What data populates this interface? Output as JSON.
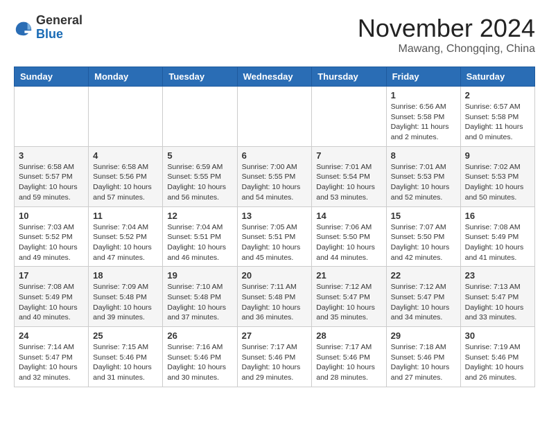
{
  "header": {
    "logo_line1": "General",
    "logo_line2": "Blue",
    "month_title": "November 2024",
    "location": "Mawang, Chongqing, China"
  },
  "days_of_week": [
    "Sunday",
    "Monday",
    "Tuesday",
    "Wednesday",
    "Thursday",
    "Friday",
    "Saturday"
  ],
  "weeks": [
    [
      {
        "day": "",
        "info": ""
      },
      {
        "day": "",
        "info": ""
      },
      {
        "day": "",
        "info": ""
      },
      {
        "day": "",
        "info": ""
      },
      {
        "day": "",
        "info": ""
      },
      {
        "day": "1",
        "info": "Sunrise: 6:56 AM\nSunset: 5:58 PM\nDaylight: 11 hours and 2 minutes."
      },
      {
        "day": "2",
        "info": "Sunrise: 6:57 AM\nSunset: 5:58 PM\nDaylight: 11 hours and 0 minutes."
      }
    ],
    [
      {
        "day": "3",
        "info": "Sunrise: 6:58 AM\nSunset: 5:57 PM\nDaylight: 10 hours and 59 minutes."
      },
      {
        "day": "4",
        "info": "Sunrise: 6:58 AM\nSunset: 5:56 PM\nDaylight: 10 hours and 57 minutes."
      },
      {
        "day": "5",
        "info": "Sunrise: 6:59 AM\nSunset: 5:55 PM\nDaylight: 10 hours and 56 minutes."
      },
      {
        "day": "6",
        "info": "Sunrise: 7:00 AM\nSunset: 5:55 PM\nDaylight: 10 hours and 54 minutes."
      },
      {
        "day": "7",
        "info": "Sunrise: 7:01 AM\nSunset: 5:54 PM\nDaylight: 10 hours and 53 minutes."
      },
      {
        "day": "8",
        "info": "Sunrise: 7:01 AM\nSunset: 5:53 PM\nDaylight: 10 hours and 52 minutes."
      },
      {
        "day": "9",
        "info": "Sunrise: 7:02 AM\nSunset: 5:53 PM\nDaylight: 10 hours and 50 minutes."
      }
    ],
    [
      {
        "day": "10",
        "info": "Sunrise: 7:03 AM\nSunset: 5:52 PM\nDaylight: 10 hours and 49 minutes."
      },
      {
        "day": "11",
        "info": "Sunrise: 7:04 AM\nSunset: 5:52 PM\nDaylight: 10 hours and 47 minutes."
      },
      {
        "day": "12",
        "info": "Sunrise: 7:04 AM\nSunset: 5:51 PM\nDaylight: 10 hours and 46 minutes."
      },
      {
        "day": "13",
        "info": "Sunrise: 7:05 AM\nSunset: 5:51 PM\nDaylight: 10 hours and 45 minutes."
      },
      {
        "day": "14",
        "info": "Sunrise: 7:06 AM\nSunset: 5:50 PM\nDaylight: 10 hours and 44 minutes."
      },
      {
        "day": "15",
        "info": "Sunrise: 7:07 AM\nSunset: 5:50 PM\nDaylight: 10 hours and 42 minutes."
      },
      {
        "day": "16",
        "info": "Sunrise: 7:08 AM\nSunset: 5:49 PM\nDaylight: 10 hours and 41 minutes."
      }
    ],
    [
      {
        "day": "17",
        "info": "Sunrise: 7:08 AM\nSunset: 5:49 PM\nDaylight: 10 hours and 40 minutes."
      },
      {
        "day": "18",
        "info": "Sunrise: 7:09 AM\nSunset: 5:48 PM\nDaylight: 10 hours and 39 minutes."
      },
      {
        "day": "19",
        "info": "Sunrise: 7:10 AM\nSunset: 5:48 PM\nDaylight: 10 hours and 37 minutes."
      },
      {
        "day": "20",
        "info": "Sunrise: 7:11 AM\nSunset: 5:48 PM\nDaylight: 10 hours and 36 minutes."
      },
      {
        "day": "21",
        "info": "Sunrise: 7:12 AM\nSunset: 5:47 PM\nDaylight: 10 hours and 35 minutes."
      },
      {
        "day": "22",
        "info": "Sunrise: 7:12 AM\nSunset: 5:47 PM\nDaylight: 10 hours and 34 minutes."
      },
      {
        "day": "23",
        "info": "Sunrise: 7:13 AM\nSunset: 5:47 PM\nDaylight: 10 hours and 33 minutes."
      }
    ],
    [
      {
        "day": "24",
        "info": "Sunrise: 7:14 AM\nSunset: 5:47 PM\nDaylight: 10 hours and 32 minutes."
      },
      {
        "day": "25",
        "info": "Sunrise: 7:15 AM\nSunset: 5:46 PM\nDaylight: 10 hours and 31 minutes."
      },
      {
        "day": "26",
        "info": "Sunrise: 7:16 AM\nSunset: 5:46 PM\nDaylight: 10 hours and 30 minutes."
      },
      {
        "day": "27",
        "info": "Sunrise: 7:17 AM\nSunset: 5:46 PM\nDaylight: 10 hours and 29 minutes."
      },
      {
        "day": "28",
        "info": "Sunrise: 7:17 AM\nSunset: 5:46 PM\nDaylight: 10 hours and 28 minutes."
      },
      {
        "day": "29",
        "info": "Sunrise: 7:18 AM\nSunset: 5:46 PM\nDaylight: 10 hours and 27 minutes."
      },
      {
        "day": "30",
        "info": "Sunrise: 7:19 AM\nSunset: 5:46 PM\nDaylight: 10 hours and 26 minutes."
      }
    ]
  ]
}
